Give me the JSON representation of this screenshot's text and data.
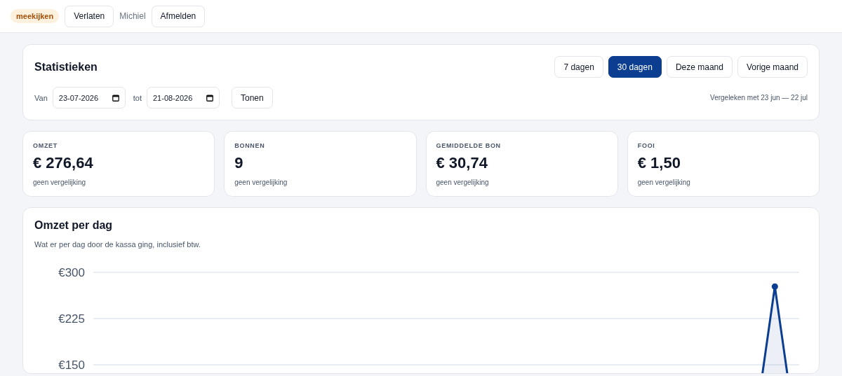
{
  "topbar": {
    "badge": "meekijken",
    "leave_button": "Verlaten",
    "user": "Michiel",
    "logout_button": "Afmelden"
  },
  "stats": {
    "title": "Statistieken",
    "presets": [
      {
        "label": "7 dagen",
        "selected": false
      },
      {
        "label": "30 dagen",
        "selected": true
      },
      {
        "label": "Deze maand",
        "selected": false
      },
      {
        "label": "Vorige maand",
        "selected": false
      }
    ],
    "from_label": "Van",
    "from_value": "23-07-2026",
    "to_label": "tot",
    "to_value": "21-08-2026",
    "show_button": "Tonen",
    "comparison": "Vergeleken met 23 jun — 22 jul"
  },
  "kpis": [
    {
      "label": "OMZET",
      "value": "€ 276,64",
      "note": "geen vergelijking"
    },
    {
      "label": "BONNEN",
      "value": "9",
      "note": "geen vergelijking"
    },
    {
      "label": "GEMIDDELDE BON",
      "value": "€ 30,74",
      "note": "geen vergelijking"
    },
    {
      "label": "FOOI",
      "value": "€ 1,50",
      "note": "geen vergelijking"
    }
  ],
  "revenue": {
    "title": "Omzet per dag",
    "subtitle": "Wat er per dag door de kassa ging, inclusief btw.",
    "chart_data": {
      "type": "area",
      "ylim": [
        0,
        300
      ],
      "yticks": [
        {
          "value": 150,
          "label": "€150"
        },
        {
          "value": 225,
          "label": "€225"
        },
        {
          "value": 300,
          "label": "€300"
        }
      ],
      "series": [
        {
          "color": "#0b3d91",
          "values": [
            0,
            0,
            0,
            0,
            0,
            0,
            0,
            0,
            0,
            0,
            0,
            0,
            0,
            0,
            0,
            0,
            0,
            0,
            0,
            0,
            0,
            0,
            0,
            0,
            0,
            0,
            0,
            0,
            277,
            0
          ]
        }
      ]
    }
  }
}
